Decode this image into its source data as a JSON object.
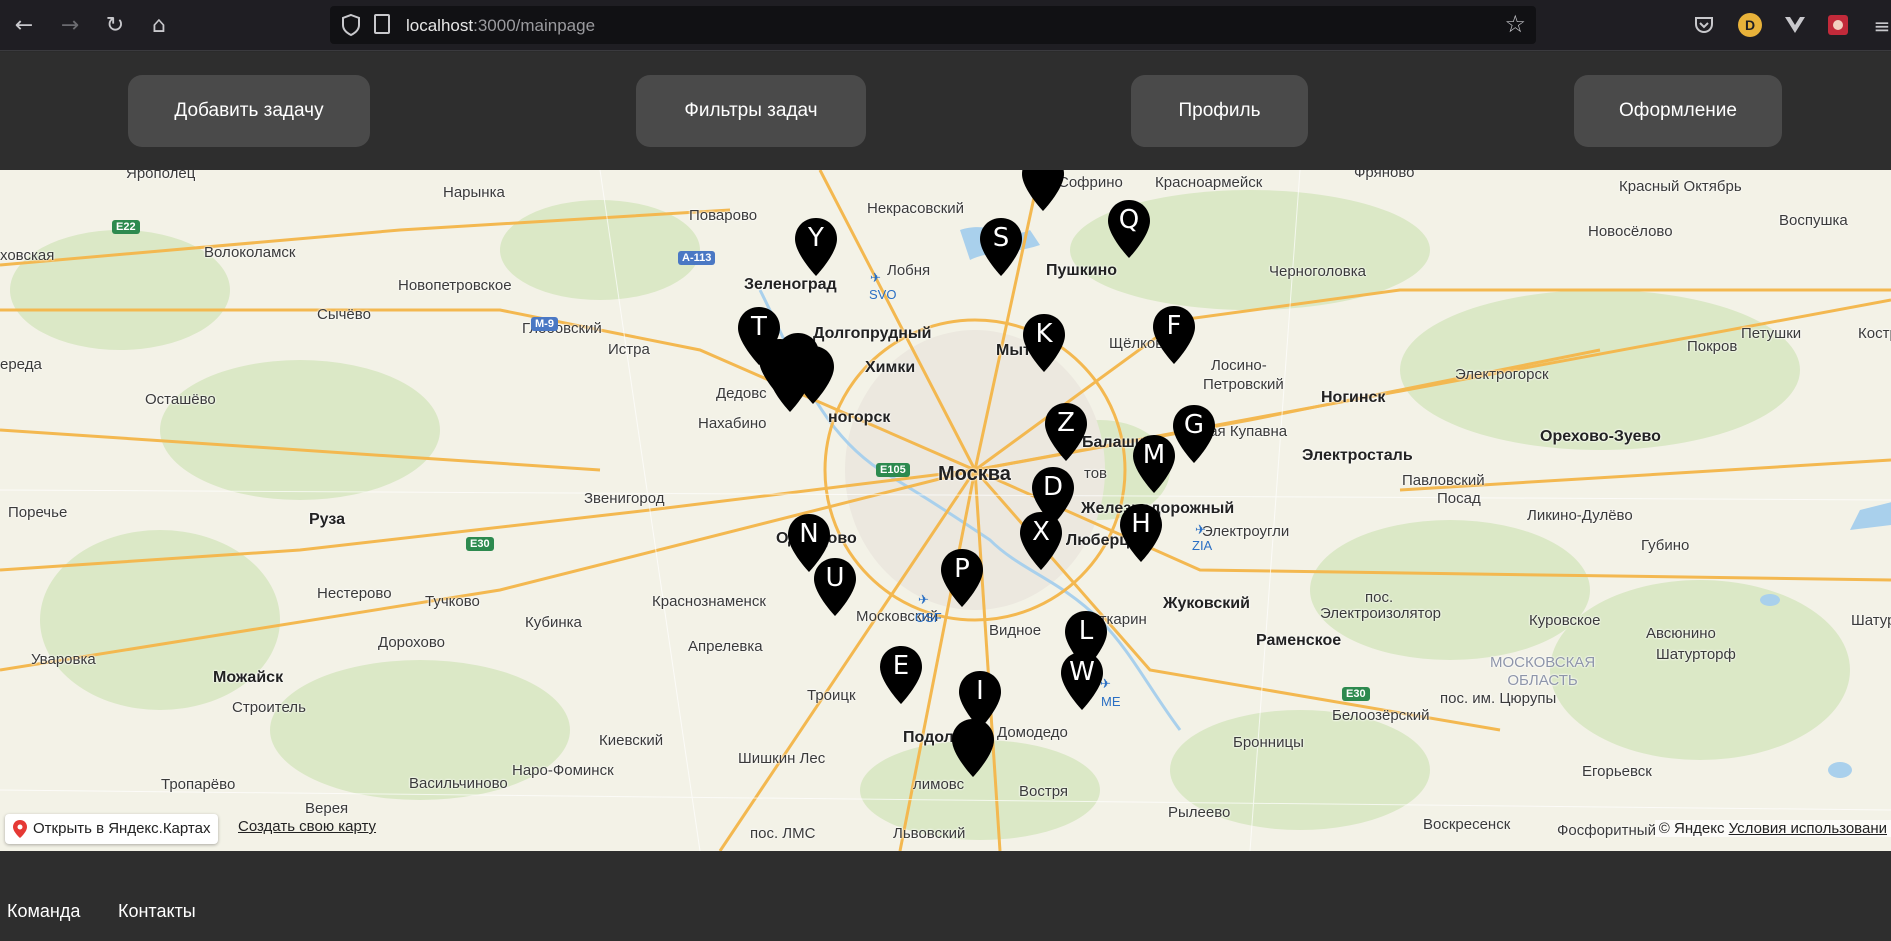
{
  "browser": {
    "url_host": "localhost",
    "url_rest": ":3000/mainpage",
    "profile_initial": "D"
  },
  "header": {
    "add_task": "Добавить задачу",
    "task_filters": "Фильтры задач",
    "profile": "Профиль",
    "appearance": "Оформление"
  },
  "map": {
    "open_in_yandex": "Открыть в Яндекс.Картах",
    "create_map": "Создать свою карту",
    "copyright": "© Яндекс",
    "terms": "Условия использовани",
    "labels": {
      "moscow": "Москва",
      "zelenograd": "Зеленоград",
      "khimki": "Химки",
      "dolgoprudny": "Долгопрудный",
      "lobnya": "Лобня",
      "nekrasovsky": "Некрасовский",
      "sofrino": "Софрино",
      "krasnoarmeysk": "Красноармейск",
      "fryanovo": "Фряново",
      "krasny_oktyabr": "Красный Октябрь",
      "pushkino": "Пушкино",
      "chernogolovka": "Черноголовка",
      "novoselovo": "Новосёлово",
      "vospushka": "Воспушка",
      "petushki": "Петушки",
      "kostr": "Костр",
      "pokrov": "Покров",
      "elektrogorsk": "Электрогорск",
      "noginsk": "Ногинск",
      "schelkovo": "Щёлково",
      "losino": "Лосино-",
      "petrovsky": "Петровский",
      "staraya_kupavna": "Старая Купавна",
      "balashikha": "Балашиха",
      "mytishchi": "Мыт",
      "elektrostal": "Электросталь",
      "orekhovo": "Орехово-Зуево",
      "pavlovsky": "Павловский",
      "posad": "Посад",
      "likino": "Ликино-Дулёво",
      "gubino": "Губино",
      "elektrougli": "Электроугли",
      "zheleznodorozhny": "Железнодорожный",
      "lyubertsy": "Люберцы",
      "reutov": "тов",
      "zhukovsky": "Жуковский",
      "ramenskoye": "Раменское",
      "pos": "пос.",
      "elektroizolyator": "Электроизолятор",
      "kurovskoye": "Куровское",
      "avsyunino": "Авсюнино",
      "shatura": "Шатура",
      "shaturtorf": "Шатурторф",
      "region_1": "МОСКОВСКАЯ",
      "region_2": "ОБЛАСТЬ",
      "tsyurupy": "пос. им. Цюрупы",
      "beloozersky": "Белоозёрский",
      "bronnitsy": "Бронницы",
      "yegoryevsk": "Егорьевск",
      "voskresensk": "Воскресенск",
      "fosforitny": "Фосфоритный",
      "ryleevo": "Рылеево",
      "domodedovo": "Домодедо",
      "vostryakovo": "Востря",
      "lytkarino": "Лыткарин",
      "vidnoye": "Видное",
      "podolsk": "Подольск",
      "klimovsk": "лимовс",
      "lvovsky": "Львовский",
      "pos_lms": "пос. ЛМС",
      "shishkin_les": "Шишкин Лес",
      "troitsk": "Троицк",
      "moskovsky": "Московский",
      "krasnoznamensk": "Краснознаменск",
      "aprelevka": "Апрелевка",
      "odintsovo": "Одинцово",
      "zvenigorod": "Звенигород",
      "nakhabino": "Нахабино",
      "dedovsk": "Дедовс",
      "krasnogorsk": "ногорск",
      "istra": "Истра",
      "glebovsky": "Глебовский",
      "povarovo": "Поварово",
      "narynka": "Нарынка",
      "yaropolets": "Ярополец",
      "volokolamsk": "Волоколамск",
      "novopetrovskoe": "Новопетровское",
      "sychevo": "Сычёво",
      "shakhovskaya": "ховская",
      "sereda": "ереда",
      "ostashevo": "Осташёво",
      "ruza": "Руза",
      "porechye": "Поречье",
      "nesterovo": "Нестерово",
      "tuchkovo": "Тучково",
      "kubinka": "Кубинка",
      "dorokhovo": "Дорохово",
      "uvarovka": "Уваровка",
      "mozhaysk": "Можайск",
      "stroitel": "Строитель",
      "kievsky": "Киевский",
      "naro_fominsk": "Наро-Фоминск",
      "vasilchinovo": "Васильчиново",
      "tropar": "Тропарёво",
      "vereya": "Верея",
      "svo": "SVO",
      "osf": "OSF",
      "zia": "ZIA",
      "dme": "ME"
    },
    "roads": {
      "e22": "E22",
      "a113": "A-113",
      "m9": "M-9",
      "e105": "E105",
      "e30": "E30",
      "e30b": "E30"
    },
    "markers": [
      "Y",
      "S",
      "Q",
      "T",
      "K",
      "F",
      "Z",
      "G",
      "M",
      "D",
      "X",
      "H",
      "N",
      "U",
      "P",
      "L",
      "W",
      "E",
      "I"
    ]
  },
  "footer": {
    "team": "Команда",
    "contacts": "Контакты"
  }
}
